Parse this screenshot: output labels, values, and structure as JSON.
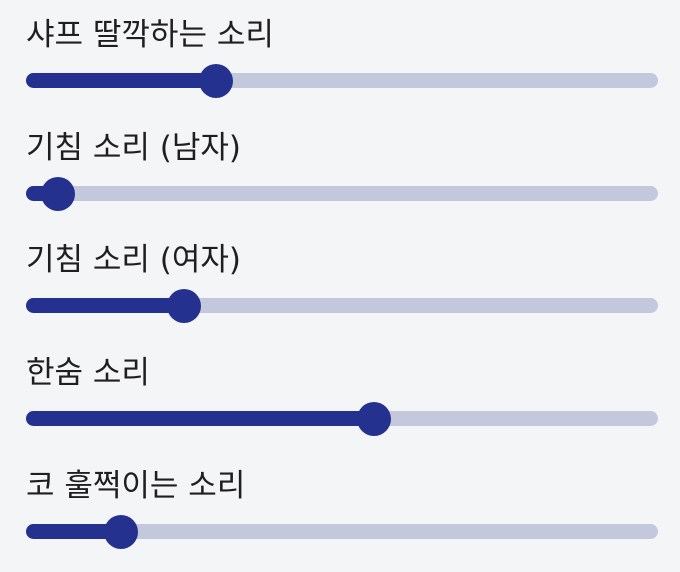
{
  "colors": {
    "background": "#f4f5f7",
    "track_active": "#24318f",
    "track_inactive": "#c3c8dd",
    "thumb": "#24318f",
    "label_text": "#1f1f1f"
  },
  "sliders": [
    {
      "label": "샤프 딸깍하는 소리",
      "value": 0.3
    },
    {
      "label": "기침 소리 (남자)",
      "value": 0.05
    },
    {
      "label": "기침 소리 (여자)",
      "value": 0.25
    },
    {
      "label": "한숨 소리",
      "value": 0.55
    },
    {
      "label": "코 훌쩍이는 소리",
      "value": 0.15
    }
  ]
}
